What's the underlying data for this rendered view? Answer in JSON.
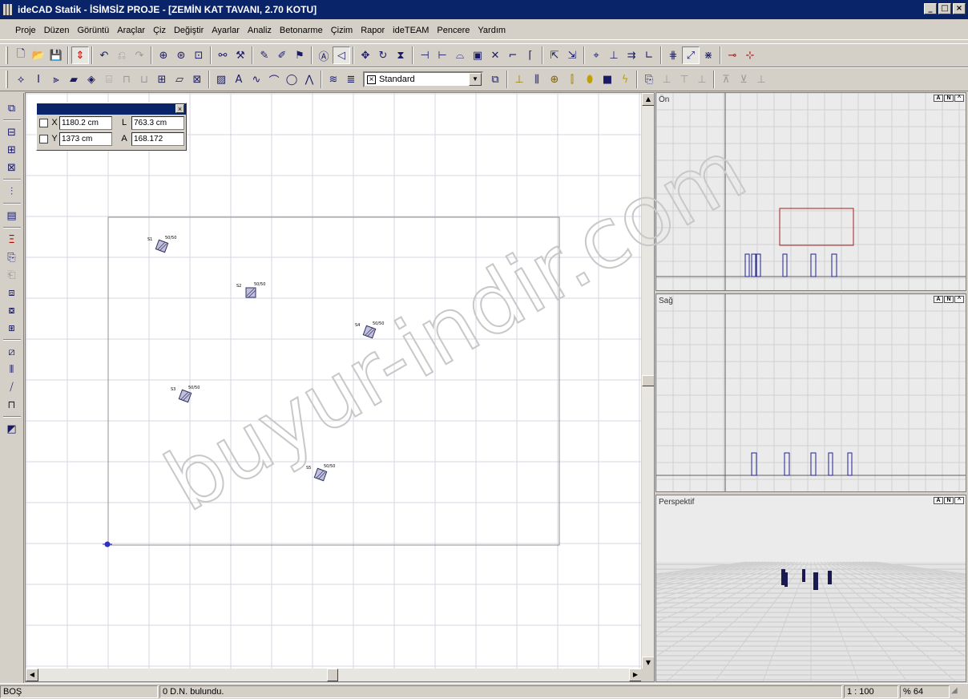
{
  "window": {
    "title": "ideCAD Statik - İSİMSİZ PROJE - [ZEMİN KAT TAVANI,  2.70 KOTU]",
    "minimize": "_",
    "maximize": "□",
    "close": "×"
  },
  "menu": [
    "Proje",
    "Düzen",
    "Görüntü",
    "Araçlar",
    "Çiz",
    "Değiştir",
    "Ayarlar",
    "Analiz",
    "Betonarme",
    "Çizim",
    "Rapor",
    "ideTEAM",
    "Pencere",
    "Yardım"
  ],
  "toolbar2": {
    "style_combo": "Standard"
  },
  "coords": {
    "x_label": "X",
    "x_value": "1180.2 cm",
    "l_label": "L",
    "l_value": "763.3 cm",
    "y_label": "Y",
    "y_value": "1373 cm",
    "a_label": "A",
    "a_value": "168.172"
  },
  "columns": [
    {
      "id": "S1",
      "size": "50/50"
    },
    {
      "id": "S2",
      "size": "50/50"
    },
    {
      "id": "S4",
      "size": "50/50"
    },
    {
      "id": "S3",
      "size": "50/50"
    },
    {
      "id": "S5",
      "size": "50/50"
    }
  ],
  "viewports": {
    "front": "Ön",
    "side": "Sağ",
    "persp": "Perspektif",
    "btn_a": "A",
    "btn_n": "N",
    "btn_up": "^"
  },
  "status": {
    "mode": "BOŞ",
    "message": "0 D.N. bulundu.",
    "scale": "1 : 100",
    "zoom": "% 64"
  },
  "watermark": "buyur-indir.com",
  "colors": {
    "titlebar": "#0a246a",
    "column_fill": "#c8c8e0",
    "grid": "#d0d0d8",
    "pane_bg": "#ebebeb"
  }
}
